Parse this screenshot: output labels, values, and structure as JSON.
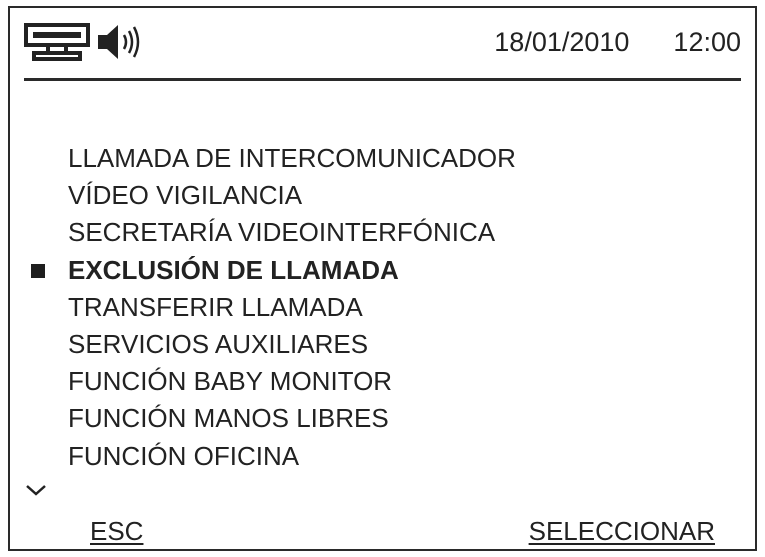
{
  "status": {
    "icons": [
      "phone-network-icon",
      "speaker-volume-icon"
    ],
    "date": "18/01/2010",
    "time": "12:00"
  },
  "menu": {
    "items": [
      {
        "label": "LLAMADA DE INTERCOMUNICADOR",
        "selected": false
      },
      {
        "label": "VÍDEO VIGILANCIA",
        "selected": false
      },
      {
        "label": "SECRETARÍA VIDEOINTERFÓNICA",
        "selected": false
      },
      {
        "label": "EXCLUSIÓN DE LLAMADA",
        "selected": true
      },
      {
        "label": "TRANSFERIR LLAMADA",
        "selected": false
      },
      {
        "label": "SERVICIOS AUXILIARES",
        "selected": false
      },
      {
        "label": "FUNCIÓN BABY MONITOR",
        "selected": false
      },
      {
        "label": "FUNCIÓN MANOS LIBRES",
        "selected": false
      },
      {
        "label": "FUNCIÓN OFICINA",
        "selected": false
      }
    ],
    "more_indicator": "chevron-down-icon"
  },
  "softkeys": {
    "left": "ESC",
    "right": "SELECCIONAR"
  }
}
